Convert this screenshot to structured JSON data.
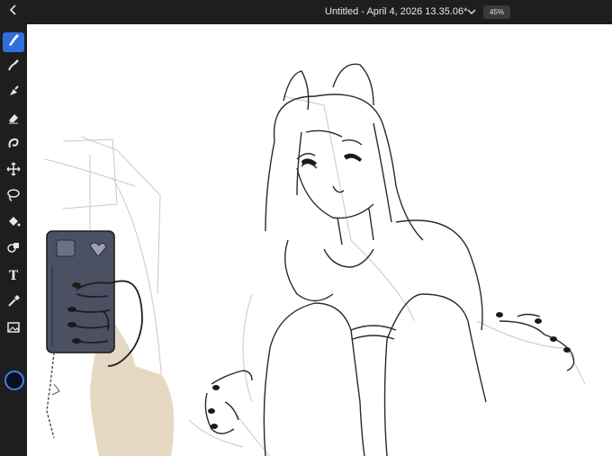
{
  "header": {
    "title": "Untitled - April 4, 2026 13.35.06*",
    "zoom": "45%"
  },
  "toolbar": {
    "tools": [
      {
        "name": "brush",
        "active": true
      },
      {
        "name": "smudge"
      },
      {
        "name": "blend"
      },
      {
        "name": "eraser"
      },
      {
        "name": "liquify"
      },
      {
        "name": "transform"
      },
      {
        "name": "lasso-select"
      },
      {
        "name": "fill"
      },
      {
        "name": "shape"
      },
      {
        "name": "text",
        "label": "T"
      },
      {
        "name": "eyedropper"
      },
      {
        "name": "image"
      }
    ],
    "current_color": "#0a0f1e"
  },
  "brush_panel": {
    "color": "#0a0f1e",
    "size": "7"
  },
  "colors": {
    "accent": "#2f6fdb",
    "bar": "#1e1e1e",
    "panel": "#262626",
    "phone": "#4b5163",
    "skin": "#e6d8c3"
  }
}
